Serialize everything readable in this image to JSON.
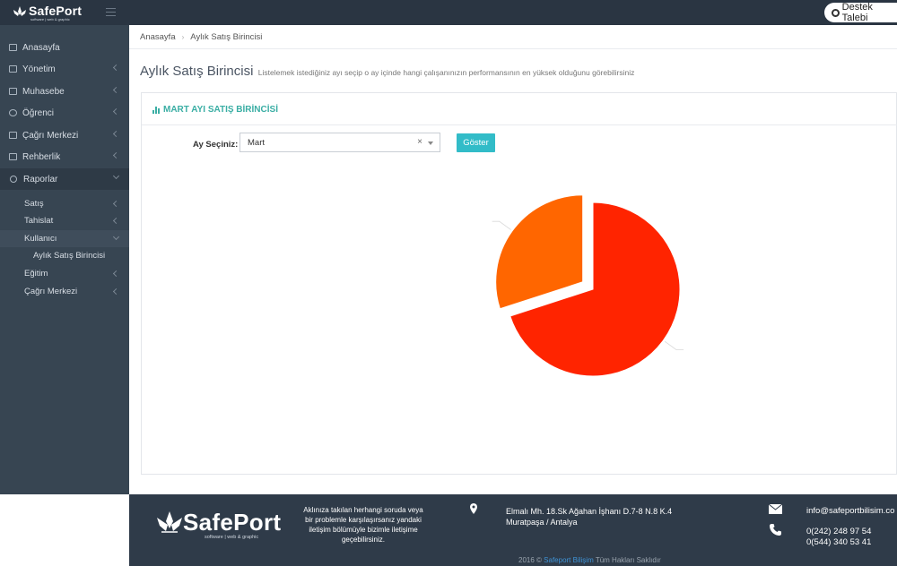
{
  "app": {
    "logo_text": "SafePort",
    "logo_sub": "software | web & graphic",
    "support_label": "Destek Talebi"
  },
  "sidebar": {
    "items": [
      {
        "label": "Anasayfa"
      },
      {
        "label": "Yönetim"
      },
      {
        "label": "Muhasebe"
      },
      {
        "label": "Öğrenci"
      },
      {
        "label": "Çağrı Merkezi"
      },
      {
        "label": "Rehberlik"
      },
      {
        "label": "Raporlar"
      }
    ],
    "sub_items": [
      {
        "label": "Satış"
      },
      {
        "label": "Tahislat"
      },
      {
        "label": "Kullanıcı"
      },
      {
        "label": "Aylık Satış Birincisi"
      },
      {
        "label": "Eğitim"
      },
      {
        "label": "Çağrı Merkezi"
      }
    ]
  },
  "breadcrumb": {
    "home": "Anasayfa",
    "current": "Aylık Satış Birincisi"
  },
  "page": {
    "title": "Aylık Satış Birincisi",
    "subtitle": "Listelemek istediğiniz ayı seçip o ay içinde hangi çalışanınızın performansının en yüksek olduğunu görebilirsiniz"
  },
  "card": {
    "title": "MART AYI SATIŞ BİRİNCİSİ",
    "month_label": "Ay Seçiniz:",
    "month_value": "Mart",
    "clear_symbol": "×",
    "show_button": "Göster"
  },
  "chart_data": {
    "type": "pie",
    "slices": [
      {
        "label": "",
        "value": 70.0,
        "color": "#ff2400"
      },
      {
        "label": "",
        "value": 30.0,
        "color": "#ff6600"
      }
    ]
  },
  "footer": {
    "logo_text": "SafePort",
    "logo_sub": "software | web & graphic",
    "help_text": "Aklınıza takılan herhangi soruda veya bir problemle karşılaşırsanız yandaki iletişim bölümüyle bizimle iletişime geçebilirsiniz.",
    "address_line1": "Elmalı Mh. 18.Sk Ağahan İşhanı D.7-8 N.8 K.4",
    "address_line2": "Muratpaşa / Antalya",
    "email": "info@safeportbilisim.co",
    "phone1": "0(242) 248 97 54",
    "phone2": "0(544) 340 53 41",
    "copyright_pre": "2016 ©",
    "copyright_brand": "Safeport Bilişim",
    "copyright_post": "Tüm Hakları Saklıdır"
  }
}
